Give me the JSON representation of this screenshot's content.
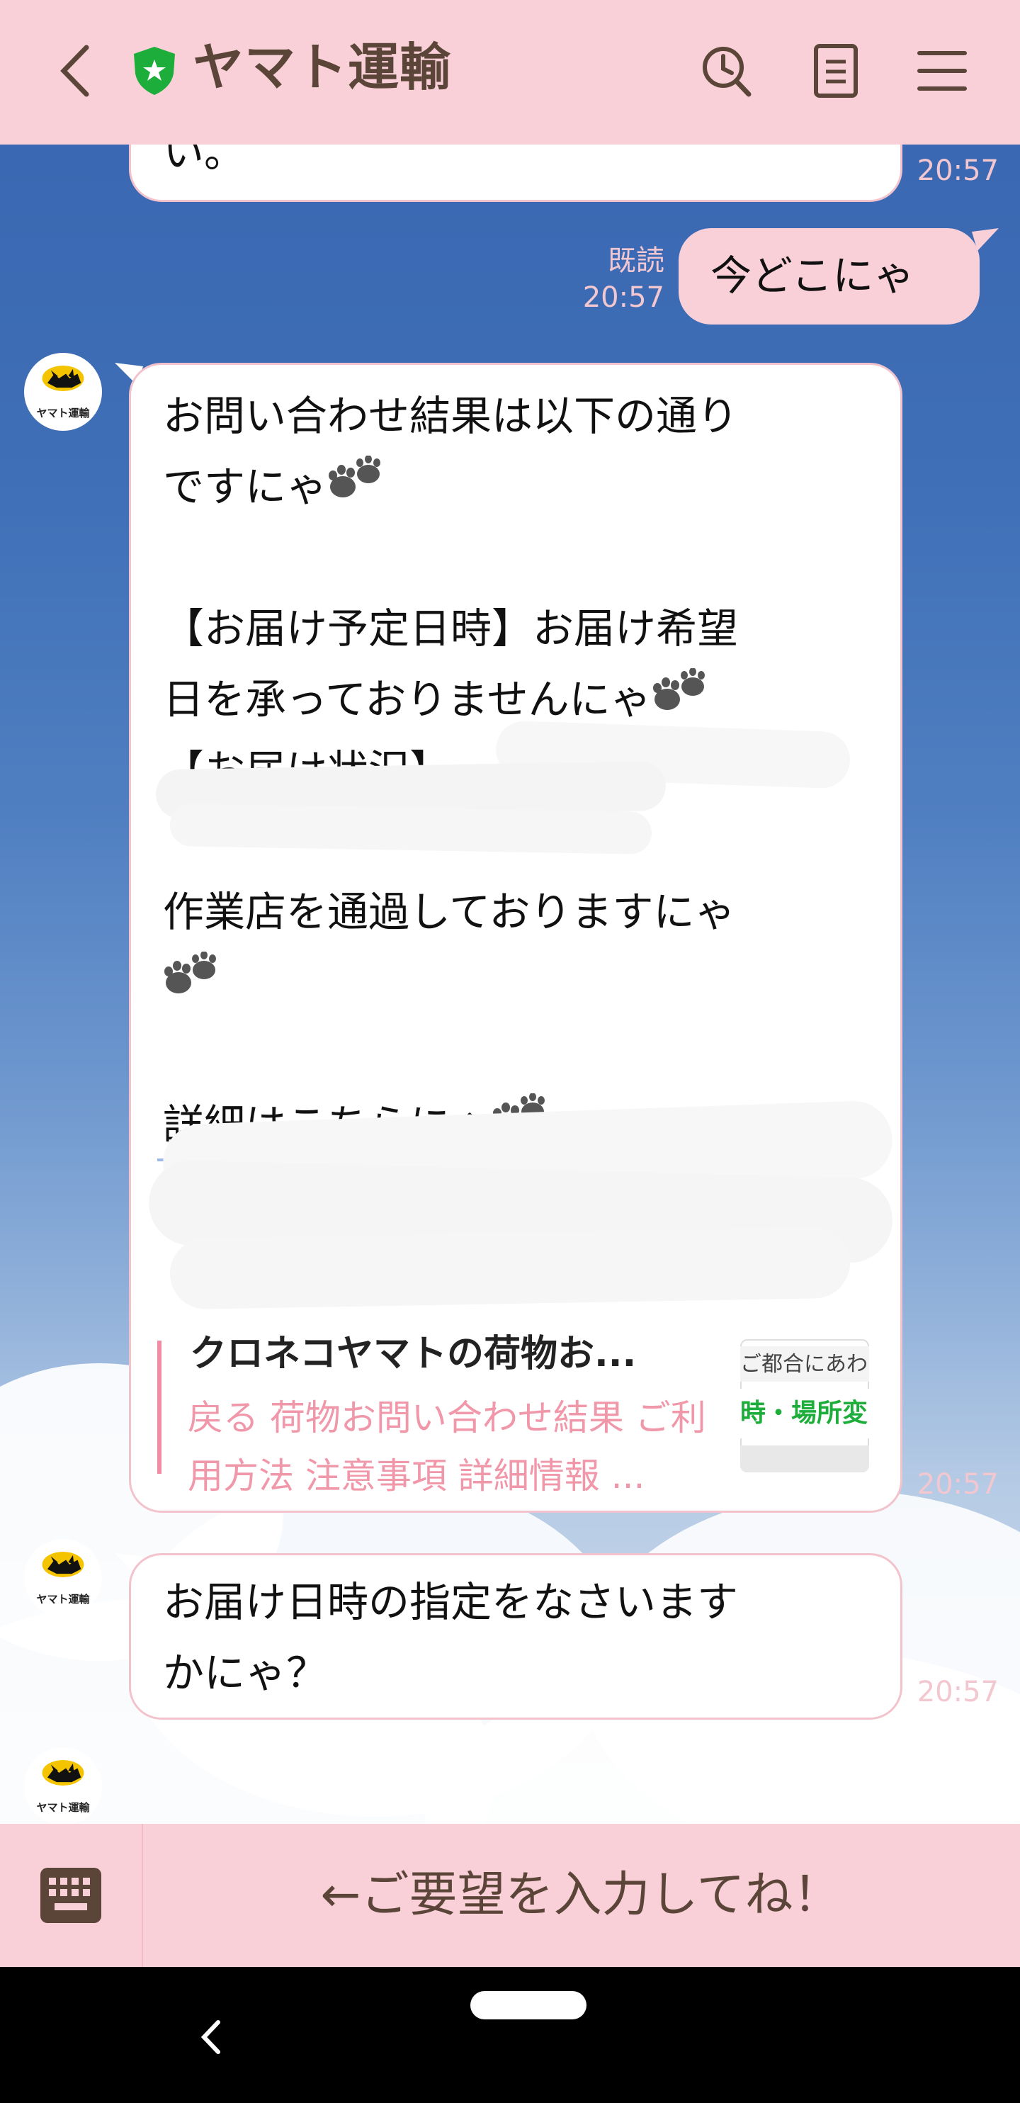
{
  "header": {
    "title": "ヤマト運輸"
  },
  "colors": {
    "header_bg": "#f9d0d8",
    "link": "#3b6fd6",
    "preview_accent": "#f08ca3",
    "verified_green": "#1dad3a"
  },
  "icons": [
    "back-arrow-icon",
    "verified-shield-icon",
    "clock-search-icon",
    "notes-icon",
    "hamburger-menu-icon",
    "keyboard-icon",
    "paw-icon"
  ],
  "messages": [
    {
      "side": "left",
      "text": "い。",
      "time": "20:57"
    },
    {
      "side": "right",
      "text": "今どこにゃ",
      "read_status": "既読",
      "time": "20:57"
    },
    {
      "side": "left",
      "lines": [
        "お問い合わせ結果は以下の通り",
        "ですにゃ",
        "【お届け予定日時】お届け希望",
        "日を承っておりませんにゃ",
        "【お届け状況】",
        "作業店を通過しておりますにゃ",
        "詳細はこちらにゃ"
      ],
      "time": "20:57",
      "preview": {
        "title": "クロネコヤマトの荷物お...",
        "description": "戻る 荷物お問い合わせ結果 ご利用方法 注意事項 詳細情報 ...",
        "thumb_line1": "ご都合にあわ",
        "thumb_line2": "時・場所変"
      }
    },
    {
      "side": "left",
      "lines": [
        "お届け日時の指定をなさいます",
        "かにゃ？"
      ],
      "time": "20:57"
    }
  ],
  "avatar": {
    "label": "ヤマト運輸"
  },
  "input": {
    "placeholder": "←ご要望を入力してね！"
  }
}
